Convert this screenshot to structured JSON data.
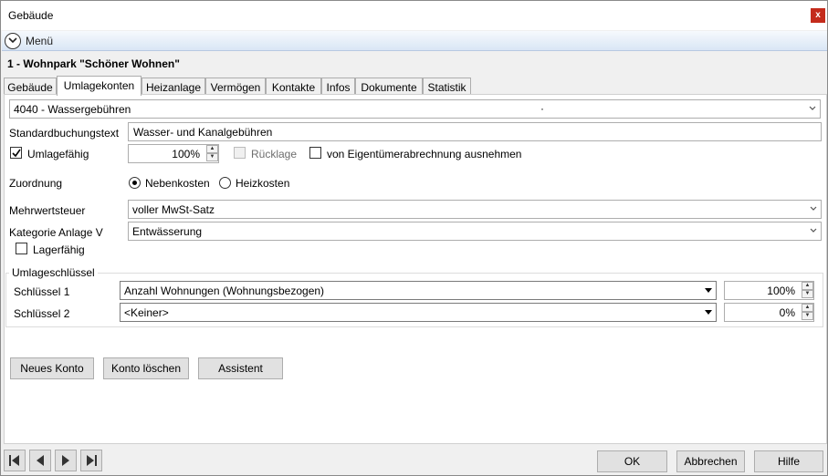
{
  "window": {
    "title": "Gebäude",
    "close_label": "x"
  },
  "menu": {
    "label": "Menü"
  },
  "record_title": "1 - Wohnpark \"Schöner Wohnen\"",
  "tabs": [
    {
      "label": "Gebäude"
    },
    {
      "label": "Umlagekonten",
      "active": true
    },
    {
      "label": "Heizanlage"
    },
    {
      "label": "Vermögen"
    },
    {
      "label": "Kontakte"
    },
    {
      "label": "Infos"
    },
    {
      "label": "Dokumente"
    },
    {
      "label": "Statistik"
    }
  ],
  "account_select": {
    "value": "4040 - Wassergebühren",
    "dot": "·"
  },
  "standard_text": {
    "label": "Standardbuchungstext",
    "value": "Wasser- und Kanalgebühren"
  },
  "umlagefaehig": {
    "label": "Umlagefähig",
    "checked": true
  },
  "percent": {
    "value": "100%"
  },
  "ruecklage": {
    "label": "Rücklage",
    "checked": false
  },
  "exclude_owner": {
    "label": "von Eigentümerabrechnung ausnehmen",
    "checked": false
  },
  "zuordnung": {
    "label": "Zuordnung",
    "options": [
      "Nebenkosten",
      "Heizkosten"
    ],
    "selected": "Nebenkosten"
  },
  "mwst": {
    "label": "Mehrwertsteuer",
    "value": "voller MwSt-Satz"
  },
  "kategorie": {
    "label": "Kategorie Anlage V",
    "value": "Entwässerung"
  },
  "lagerfaehig": {
    "label": "Lagerfähig",
    "checked": false
  },
  "umlageschluessel": {
    "title": "Umlageschlüssel",
    "rows": [
      {
        "label": "Schlüssel 1",
        "value": "Anzahl Wohnungen (Wohnungsbezogen)",
        "percent": "100%"
      },
      {
        "label": "Schlüssel 2",
        "value": "<Keiner>",
        "percent": "0%"
      }
    ]
  },
  "buttons": {
    "new_account": "Neues Konto",
    "delete_account": "Konto löschen",
    "assistant": "Assistent"
  },
  "footer": {
    "ok": "OK",
    "cancel": "Abbrechen",
    "help": "Hilfe"
  }
}
